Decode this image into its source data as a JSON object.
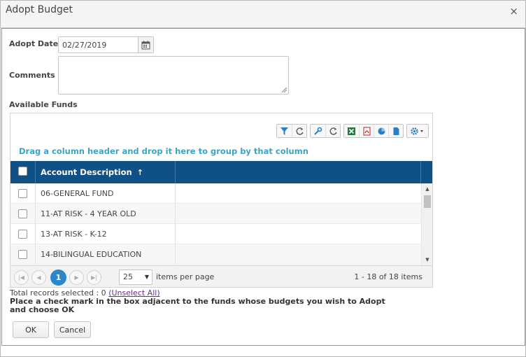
{
  "window": {
    "title": "Adopt Budget",
    "close_glyph": "×"
  },
  "form": {
    "adopt_date_label": "Adopt Date",
    "adopt_date_value": "02/27/2019",
    "calendar_icon": "calendar-icon",
    "comments_label": "Comments",
    "comments_value": "",
    "available_funds_label": "Available Funds"
  },
  "grid": {
    "toolbar_icons": [
      "filter-icon",
      "refresh-icon",
      "wrench-icon",
      "refresh-icon",
      "excel-icon",
      "pdf-icon",
      "chart-icon",
      "document-icon",
      "gear-icon"
    ],
    "group_hint": "Drag a column header and drop it here to group by that column",
    "header_color": "#0f5186",
    "columns": {
      "description": "Account Description",
      "sort_indicator": "↑"
    },
    "rows": [
      {
        "description": "06-GENERAL FUND",
        "checked": false
      },
      {
        "description": "11-AT RISK - 4 YEAR OLD",
        "checked": false
      },
      {
        "description": "13-AT RISK - K-12",
        "checked": false
      },
      {
        "description": "14-BILINGUAL EDUCATION",
        "checked": false
      }
    ],
    "pager": {
      "current_page": "1",
      "page_size": "25",
      "items_per_page_label": "items per page",
      "info": "1 - 18 of 18 items",
      "accent_color": "#2b87c9"
    }
  },
  "footer": {
    "total_selected_text": "Total records selected : 0",
    "unselect_all_label": "(Unselect All)",
    "instructions": "Place a check mark in the box adjacent to the funds whose budgets you wish to Adopt and choose OK",
    "ok_label": "OK",
    "cancel_label": "Cancel"
  }
}
